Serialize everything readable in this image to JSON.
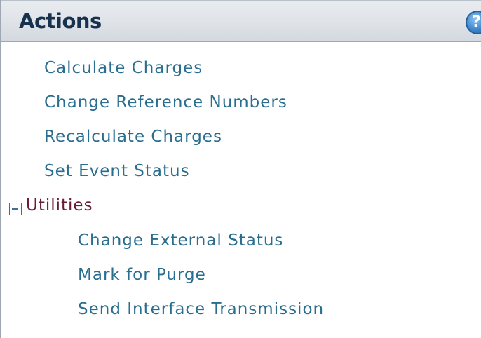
{
  "panel": {
    "title": "Actions",
    "help_icon": "help-icon",
    "actions": [
      "Calculate Charges",
      "Change Reference Numbers",
      "Recalculate Charges",
      "Set Event Status"
    ],
    "group": {
      "label": "Utilities",
      "toggle_icon": "collapse-minus-icon",
      "expanded": true,
      "items": [
        "Change External Status",
        "Mark for Purge",
        "Send Interface Transmission"
      ]
    }
  },
  "colors": {
    "title": "#17324f",
    "link": "#2a6e8f",
    "group_label": "#6a1b38",
    "header_bg": "#dfe3e8"
  }
}
